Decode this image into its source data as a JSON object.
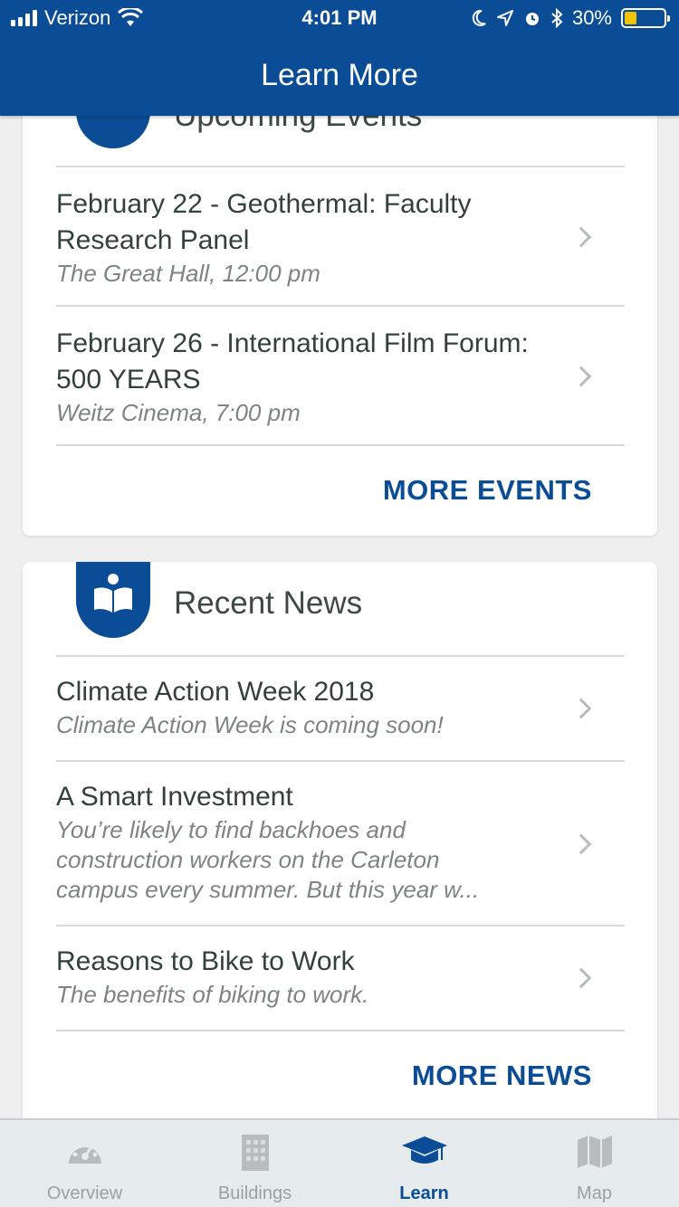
{
  "status_bar": {
    "carrier": "Verizon",
    "time": "4:01 PM",
    "battery": "30%",
    "battery_level": 0.3
  },
  "nav": {
    "title": "Learn More"
  },
  "events": {
    "title": "Upcoming Events",
    "items": [
      {
        "title": "February 22 - Geothermal: Faculty Research Panel",
        "subtitle": "The Great Hall, 12:00 pm"
      },
      {
        "title": "February 26 - International Film Forum: 500 YEARS",
        "subtitle": "Weitz Cinema, 7:00 pm"
      }
    ],
    "more_label": "MORE EVENTS"
  },
  "news": {
    "title": "Recent News",
    "items": [
      {
        "title": "Climate Action Week 2018",
        "subtitle": "Climate Action Week is coming soon!"
      },
      {
        "title": "A Smart Investment",
        "subtitle": "You’re likely to find backhoes and construction workers on the Carleton campus every summer. But this year w..."
      },
      {
        "title": "Reasons to Bike to Work",
        "subtitle": "The benefits of biking to work."
      }
    ],
    "more_label": "MORE NEWS"
  },
  "tabs": [
    {
      "label": "Overview",
      "icon": "gauge-icon",
      "active": false
    },
    {
      "label": "Buildings",
      "icon": "building-icon",
      "active": false
    },
    {
      "label": "Learn",
      "icon": "graduation-cap-icon",
      "active": true
    },
    {
      "label": "Map",
      "icon": "map-icon",
      "active": false
    }
  ],
  "colors": {
    "primary": "#0a4d96",
    "battery_fill": "#f5c400",
    "background": "#efefef"
  }
}
